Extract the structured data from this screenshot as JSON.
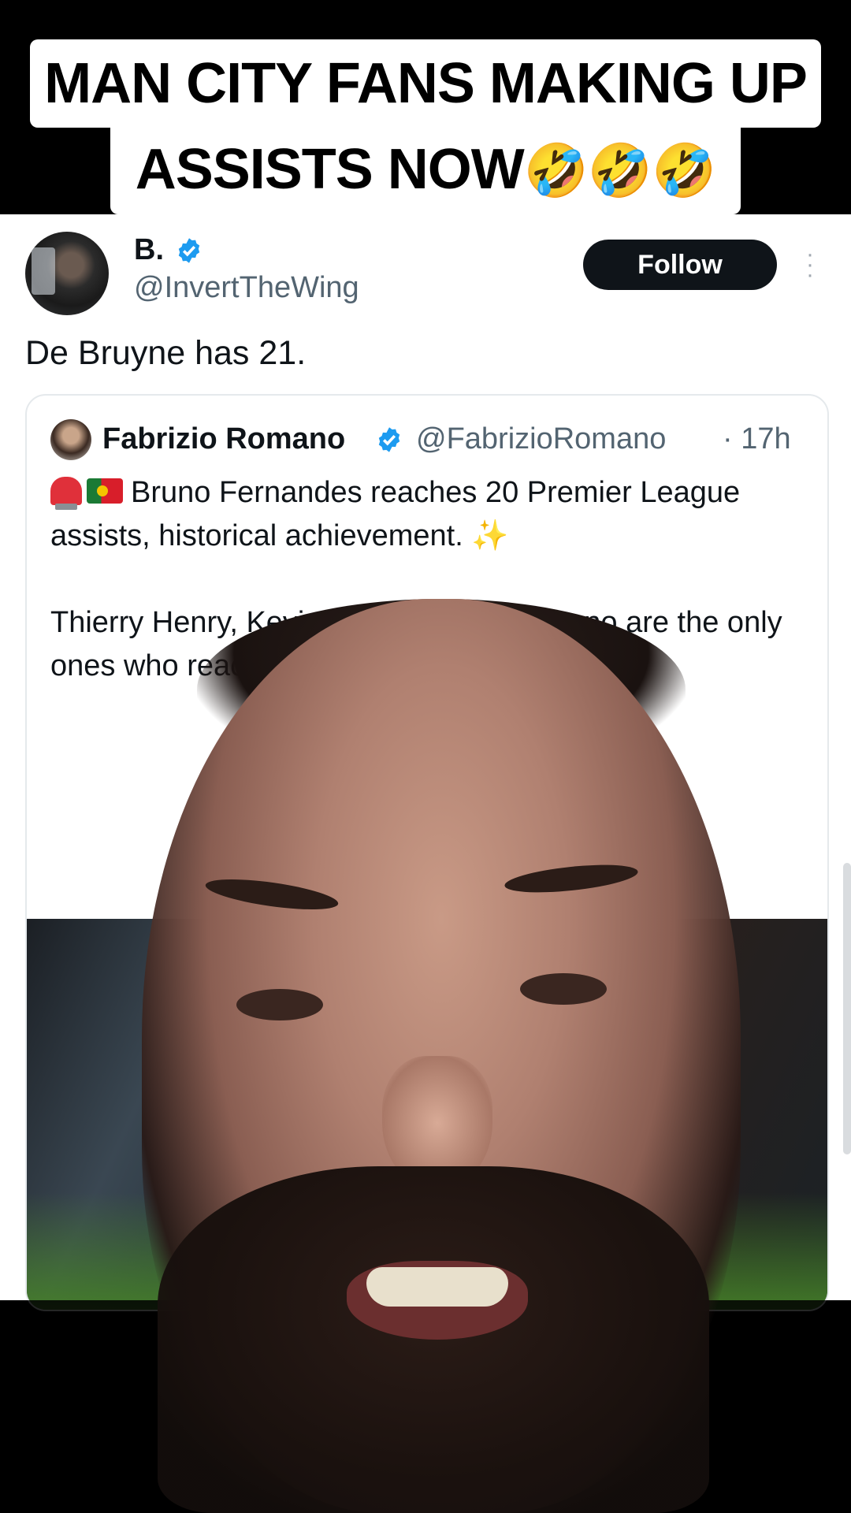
{
  "caption": {
    "line1": "MAN CITY FANS MAKING UP",
    "line2": "ASSISTS NOW",
    "line2_emoji": "🤣🤣🤣"
  },
  "tweet": {
    "author_name": "B.",
    "author_handle": "@InvertTheWing",
    "follow_label": "Follow",
    "text": "De Bruyne has 21.",
    "quoted": {
      "author_name": "Fabrizio Romano",
      "author_handle": "@FabrizioRomano",
      "time": "· 17h",
      "line1": "Bruno Fernandes reaches 20 Premier League assists, historical achievement.",
      "sparkle": "✨",
      "line2": "Thierry Henry, Kevin De Bruyne and Bruno are the only ones who reached 20 PL assists."
    }
  },
  "icons": {
    "verified": "verified-badge-icon",
    "more": "more-options-icon"
  },
  "colors": {
    "verified": "#1d9bf0",
    "follow_bg": "#0f1419",
    "handle": "#536471"
  }
}
